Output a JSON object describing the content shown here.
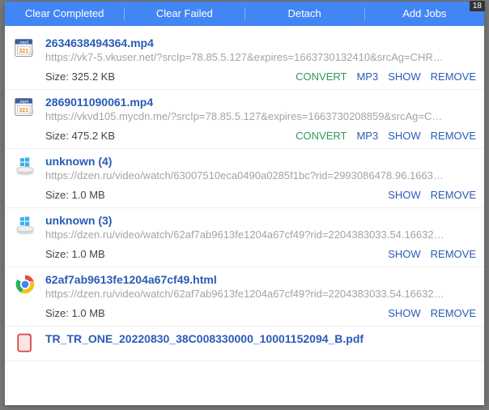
{
  "toolbar": {
    "clear_completed": "Clear Completed",
    "clear_failed": "Clear Failed",
    "detach": "Detach",
    "add_jobs": "Add Jobs",
    "badge": "18"
  },
  "action_labels": {
    "convert": "CONVERT",
    "mp3": "MP3",
    "show": "SHOW",
    "remove": "REMOVE"
  },
  "items": [
    {
      "icon": "mp4",
      "name": "2634638494364.mp4",
      "url": "https://vk7-5.vkuser.net/?srcIp=78.85.5.127&expires=1663730132410&srcAg=CHR…",
      "size": "Size: 325.2 KB",
      "actions": [
        "convert",
        "mp3",
        "show",
        "remove"
      ]
    },
    {
      "icon": "mp4",
      "name": "2869011090061.mp4",
      "url": "https://vkvd105.mycdn.me/?srcIp=78.85.5.127&expires=1663730208859&srcAg=C…",
      "size": "Size: 475.2 KB",
      "actions": [
        "convert",
        "mp3",
        "show",
        "remove"
      ]
    },
    {
      "icon": "win",
      "name": "unknown (4)",
      "url": "https://dzen.ru/video/watch/63007510eca0490a0285f1bc?rid=2993086478.96.1663…",
      "size": "Size: 1.0 MB",
      "actions": [
        "show",
        "remove"
      ]
    },
    {
      "icon": "win",
      "name": "unknown (3)",
      "url": "https://dzen.ru/video/watch/62af7ab9613fe1204a67cf49?rid=2204383033.54.16632…",
      "size": "Size: 1.0 MB",
      "actions": [
        "show",
        "remove"
      ]
    },
    {
      "icon": "chrome",
      "name": "62af7ab9613fe1204a67cf49.html",
      "url": "https://dzen.ru/video/watch/62af7ab9613fe1204a67cf49?rid=2204383033.54.16632…",
      "size": "Size: 1.0 MB",
      "actions": [
        "show",
        "remove"
      ]
    },
    {
      "icon": "pdf",
      "name": "TR_TR_ONE_20220830_38C008330000_10001152094_B.pdf",
      "url": "",
      "size": "",
      "actions": []
    }
  ]
}
